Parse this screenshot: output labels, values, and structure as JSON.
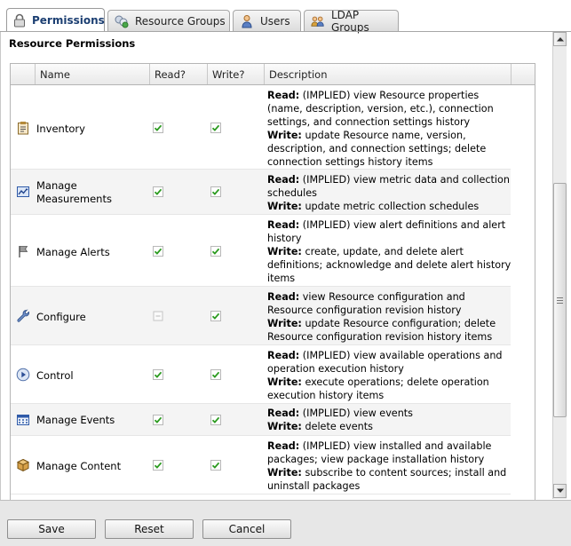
{
  "tabs": [
    {
      "label": "Permissions",
      "icon": "lock-icon",
      "selected": true
    },
    {
      "label": "Resource Groups",
      "icon": "resource-groups-icon",
      "selected": false
    },
    {
      "label": "Users",
      "icon": "user-icon",
      "selected": false
    },
    {
      "label": "LDAP Groups",
      "icon": "ldap-groups-icon",
      "selected": false
    }
  ],
  "section_title": "Resource Permissions",
  "columns": {
    "name": "Name",
    "read": "Read?",
    "write": "Write?",
    "description": "Description"
  },
  "rows": [
    {
      "name": "Inventory",
      "icon": "inventory-icon",
      "read": "checked",
      "write": "checked",
      "desc": [
        {
          "label": "Read:",
          "text": " (IMPLIED) view Resource properties (name, description, version, etc.), connection settings, and connection settings history"
        },
        {
          "label": "Write:",
          "text": " update Resource name, version, description, and connection settings; delete connection settings history items"
        }
      ]
    },
    {
      "name": "Manage Measurements",
      "icon": "measurements-icon",
      "read": "checked",
      "write": "checked",
      "desc": [
        {
          "label": "Read:",
          "text": " (IMPLIED) view metric data and collection schedules"
        },
        {
          "label": "Write:",
          "text": " update metric collection schedules"
        }
      ]
    },
    {
      "name": "Manage Alerts",
      "icon": "flag-icon",
      "read": "checked",
      "write": "checked",
      "desc": [
        {
          "label": "Read:",
          "text": " (IMPLIED) view alert definitions and alert history"
        },
        {
          "label": "Write:",
          "text": " create, update, and delete alert definitions; acknowledge and delete alert history items"
        }
      ]
    },
    {
      "name": "Configure",
      "icon": "wrench-icon",
      "read": "disabled",
      "write": "checked",
      "desc": [
        {
          "label": "Read:",
          "text": " view Resource configuration and Resource configuration revision history"
        },
        {
          "label": "Write:",
          "text": " update Resource configuration; delete Resource configuration revision history items"
        }
      ]
    },
    {
      "name": "Control",
      "icon": "play-icon",
      "read": "checked",
      "write": "checked",
      "desc": [
        {
          "label": "Read:",
          "text": " (IMPLIED) view available operations and operation execution history"
        },
        {
          "label": "Write:",
          "text": " execute operations; delete operation execution history items"
        }
      ]
    },
    {
      "name": "Manage Events",
      "icon": "events-icon",
      "read": "checked",
      "write": "checked",
      "desc": [
        {
          "label": "Read:",
          "text": " (IMPLIED) view events"
        },
        {
          "label": "Write:",
          "text": " delete events"
        }
      ]
    },
    {
      "name": "Manage Content",
      "icon": "package-icon",
      "read": "checked",
      "write": "checked",
      "desc": [
        {
          "label": "Read:",
          "text": " (IMPLIED) view installed and available packages; view package installation history"
        },
        {
          "label": "Write:",
          "text": " subscribe to content sources; install and uninstall packages"
        }
      ]
    }
  ],
  "buttons": {
    "save": "Save",
    "reset": "Reset",
    "cancel": "Cancel"
  }
}
